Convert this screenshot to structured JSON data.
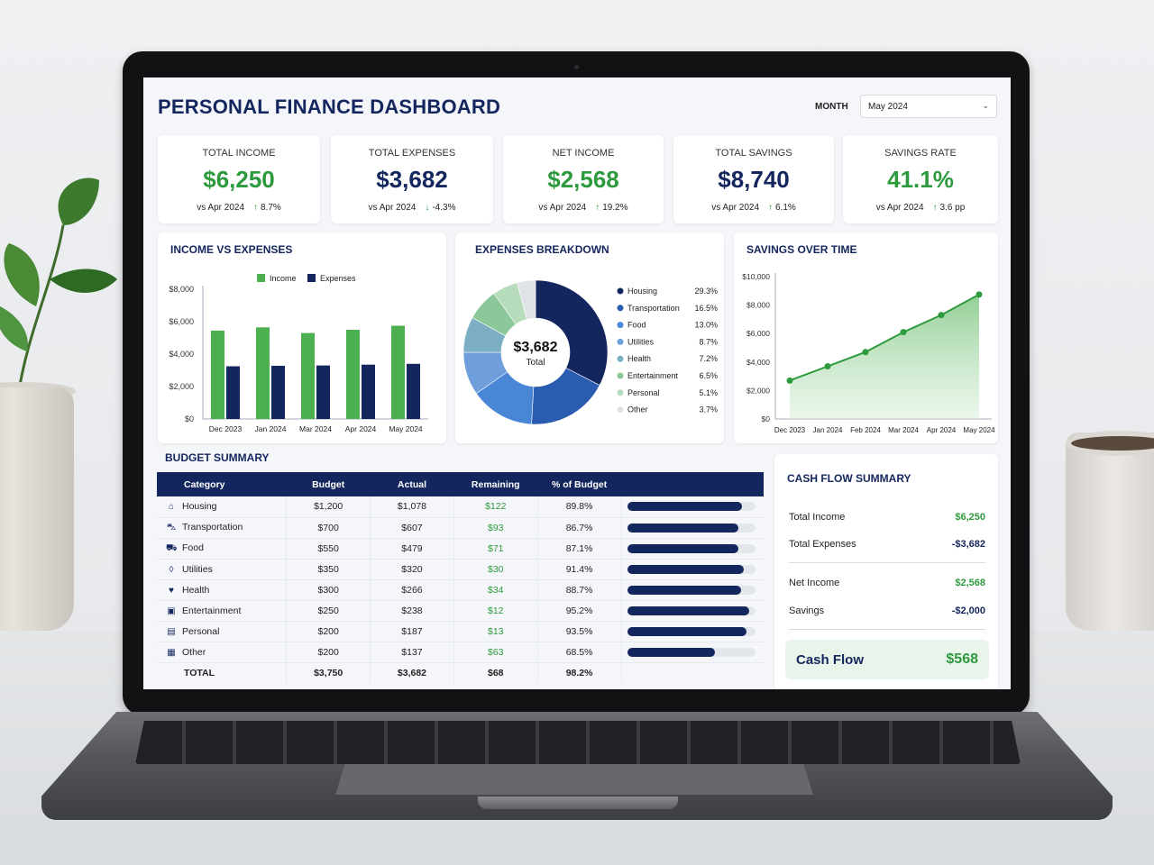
{
  "header": {
    "title": "PERSONAL FINANCE DASHBOARD",
    "month_label": "MONTH",
    "month_value": "May 2024"
  },
  "kpis": [
    {
      "label": "TOTAL INCOME",
      "value": "$6,250",
      "compare": "vs Apr 2024",
      "change": "8.7%",
      "color": "#2e9a3e"
    },
    {
      "label": "TOTAL EXPENSES",
      "value": "$3,682",
      "compare": "vs Apr 2024",
      "change": "-4.3%",
      "color": "#14265e"
    },
    {
      "label": "NET INCOME",
      "value": "$2,568",
      "compare": "vs Apr 2024",
      "change": "19.2%",
      "color": "#2e9a3e"
    },
    {
      "label": "TOTAL SAVINGS",
      "value": "$8,740",
      "compare": "vs Apr 2024",
      "change": "6.1%",
      "color": "#14265e"
    },
    {
      "label": "SAVINGS RATE",
      "value": "41.1%",
      "compare": "vs Apr 2024",
      "change": "3.6 pp",
      "color": "#2e9a3e"
    }
  ],
  "panels": {
    "income_vs_expenses_title": "INCOME VS EXPENSES",
    "expenses_breakdown_title": "EXPENSES BREAKDOWN",
    "savings_over_time_title": "SAVINGS OVER TIME",
    "budget_summary_title": "BUDGET SUMMARY",
    "cash_flow_title": "CASH FLOW SUMMARY"
  },
  "chart_data": [
    {
      "type": "bar",
      "title": "INCOME VS EXPENSES",
      "categories": [
        "Dec 2023",
        "Jan 2024",
        "Mar 2024",
        "Apr 2024",
        "May 2024"
      ],
      "series": [
        {
          "name": "Income",
          "values": [
            5450,
            5650,
            5300,
            5500,
            5750
          ],
          "color": "#4caf50"
        },
        {
          "name": "Expenses",
          "values": [
            3250,
            3280,
            3300,
            3350,
            3400
          ],
          "color": "#14265e"
        }
      ],
      "ylim": [
        0,
        8000
      ],
      "yticks": [
        "$0",
        "$2,000",
        "$4,000",
        "$6,000",
        "$8,000"
      ],
      "legend": "top"
    },
    {
      "type": "pie",
      "title": "EXPENSES BREAKDOWN",
      "center_value": "$3,682",
      "center_label": "Total",
      "slices": [
        {
          "label": "Housing",
          "value": 29.3,
          "display": "29.3%",
          "color": "#14265e"
        },
        {
          "label": "Transportation",
          "value": 16.5,
          "display": "16.5%",
          "color": "#2a5db0"
        },
        {
          "label": "Food",
          "value": 13.0,
          "display": "13.0%",
          "color": "#4a86d6"
        },
        {
          "label": "Utilities",
          "value": 8.7,
          "display": "8.7%",
          "color": "#6e9fdc"
        },
        {
          "label": "Health",
          "value": 7.2,
          "display": "7.2%",
          "color": "#7cafc4"
        },
        {
          "label": "Entertainment",
          "value": 6.5,
          "display": "6.5%",
          "color": "#8cc79a"
        },
        {
          "label": "Personal",
          "value": 5.1,
          "display": "5.1%",
          "color": "#b6dcbc"
        },
        {
          "label": "Other",
          "value": 3.7,
          "display": "3.7%",
          "color": "#dfe3e8"
        }
      ],
      "legend": "right"
    },
    {
      "type": "area",
      "title": "SAVINGS OVER TIME",
      "x": [
        "Dec 2023",
        "Jan 2024",
        "Feb 2024",
        "Mar 2024",
        "Apr 2024",
        "May 2024"
      ],
      "values": [
        2700,
        3700,
        4700,
        6100,
        7300,
        8740
      ],
      "ylim": [
        0,
        10000
      ],
      "yticks": [
        "$0",
        "$2,000",
        "$4,000",
        "$6,000",
        "$8,000",
        "$10,000"
      ],
      "color": "#2e9a3e"
    }
  ],
  "budget": {
    "headers": [
      "Category",
      "Budget",
      "Actual",
      "Remaining",
      "% of Budget"
    ],
    "rows": [
      {
        "icon": "house-icon",
        "glyph": "⌂",
        "category": "Housing",
        "budget": "$1,200",
        "actual": "$1,078",
        "remaining": "$122",
        "pct": "89.8%",
        "fill": 0.898
      },
      {
        "icon": "car-icon",
        "glyph": "⛍",
        "category": "Transportation",
        "budget": "$700",
        "actual": "$607",
        "remaining": "$93",
        "pct": "86.7%",
        "fill": 0.867
      },
      {
        "icon": "cart-icon",
        "glyph": "⛟",
        "category": "Food",
        "budget": "$550",
        "actual": "$479",
        "remaining": "$71",
        "pct": "87.1%",
        "fill": 0.871
      },
      {
        "icon": "drop-icon",
        "glyph": "◊",
        "category": "Utilities",
        "budget": "$350",
        "actual": "$320",
        "remaining": "$30",
        "pct": "91.4%",
        "fill": 0.914
      },
      {
        "icon": "heart-icon",
        "glyph": "♥",
        "category": "Health",
        "budget": "$300",
        "actual": "$266",
        "remaining": "$34",
        "pct": "88.7%",
        "fill": 0.887
      },
      {
        "icon": "ticket-icon",
        "glyph": "▣",
        "category": "Entertainment",
        "budget": "$250",
        "actual": "$238",
        "remaining": "$12",
        "pct": "95.2%",
        "fill": 0.952
      },
      {
        "icon": "bag-icon",
        "glyph": "▤",
        "category": "Personal",
        "budget": "$200",
        "actual": "$187",
        "remaining": "$13",
        "pct": "93.5%",
        "fill": 0.935
      },
      {
        "icon": "box-icon",
        "glyph": "▦",
        "category": "Other",
        "budget": "$200",
        "actual": "$137",
        "remaining": "$63",
        "pct": "68.5%",
        "fill": 0.685
      }
    ],
    "total": {
      "label": "TOTAL",
      "budget": "$3,750",
      "actual": "$3,682",
      "remaining": "$68",
      "pct": "98.2%"
    }
  },
  "cash_flow": {
    "total_income_label": "Total Income",
    "total_income": "$6,250",
    "total_expenses_label": "Total Expenses",
    "total_expenses": "-$3,682",
    "net_income_label": "Net Income",
    "net_income": "$2,568",
    "savings_label": "Savings",
    "savings": "-$2,000",
    "cash_flow_label": "Cash Flow",
    "cash_flow": "$568"
  }
}
